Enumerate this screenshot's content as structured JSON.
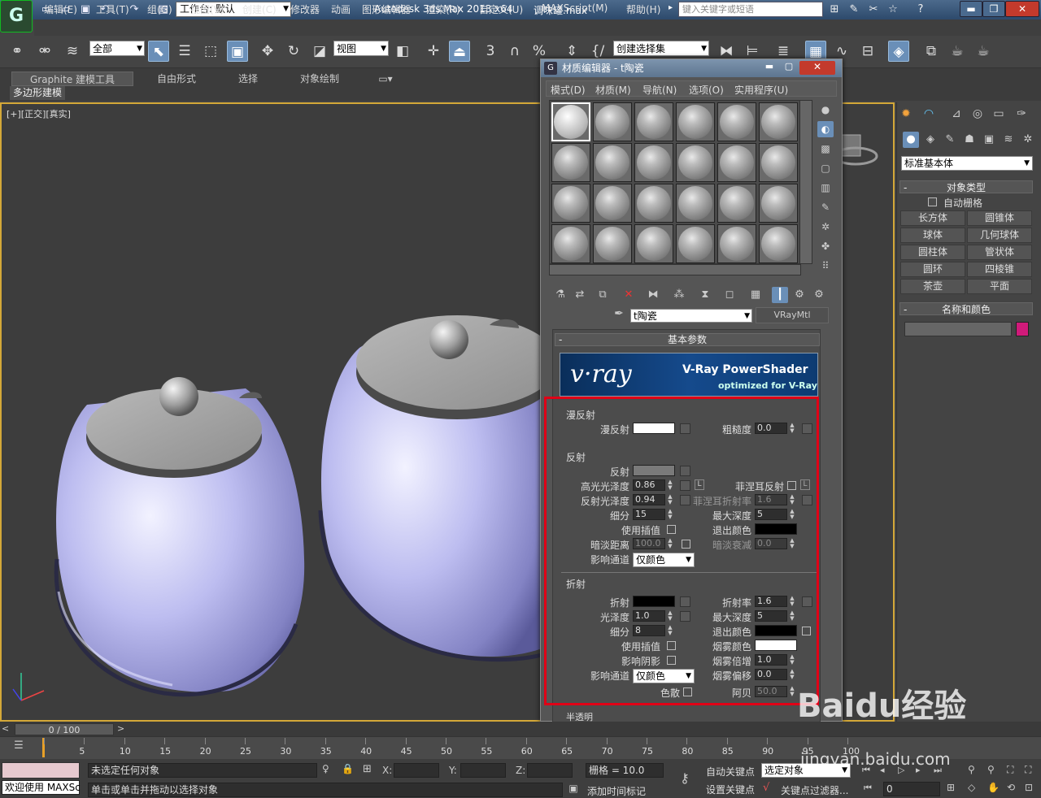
{
  "titlebar": {
    "app_icon": "3ds-max-logo",
    "workspace_label": "工作台: 默认",
    "app_title": "Autodesk 3ds Max  2013 x64",
    "file_name": "调味罐.max",
    "search_placeholder": "键入关键字或短语",
    "window_controls": [
      "minimize",
      "restore",
      "close"
    ]
  },
  "menubar": [
    "编辑(E)",
    "工具(T)",
    "组(G)",
    "视图(V)",
    "创建(C)",
    "修改器",
    "动画",
    "图形编辑器",
    "渲染(R)",
    "自定义(U)",
    "MAXScript(M)",
    "帮助(H)"
  ],
  "toolbar": {
    "selection_filter": "全部",
    "ref_coord": "视图",
    "named_selection": "创建选择集",
    "snap_number": "3",
    "percent_label": "%"
  },
  "ribbon": {
    "tabs": [
      "Graphite 建模工具",
      "自由形式",
      "选择",
      "对象绘制"
    ],
    "active_tab": "Graphite 建模工具",
    "subpanel": "多边形建模"
  },
  "viewport": {
    "label": "[+][正交][真实]"
  },
  "command_panel": {
    "category_dropdown": "标准基本体",
    "object_type_header": "对象类型",
    "autogrid_label": "自动栅格",
    "objects": [
      "长方体",
      "圆锥体",
      "球体",
      "几何球体",
      "圆柱体",
      "管状体",
      "圆环",
      "四棱锥",
      "茶壶",
      "平面"
    ],
    "name_color_header": "名称和颜色",
    "object_color": "#d01a7a"
  },
  "material_editor": {
    "title": "材质编辑器 - t陶瓷",
    "menus": [
      "模式(D)",
      "材质(M)",
      "导航(N)",
      "选项(O)",
      "实用程序(U)"
    ],
    "material_name": "t陶瓷",
    "material_type": "VRayMtl",
    "basic_params_header": "基本参数",
    "banner": {
      "logo": "v·ray",
      "line1": "V-Ray PowerShader",
      "line2": "optimized for V-Ray"
    },
    "diffuse": {
      "group": "漫反射",
      "diffuse_label": "漫反射",
      "diffuse_color": "#ffffff",
      "roughness_label": "粗糙度",
      "roughness": "0.0"
    },
    "reflection": {
      "group": "反射",
      "reflect_label": "反射",
      "reflect_color": "#7a7a7a",
      "hilight_gloss_label": "高光光泽度",
      "hilight_gloss": "0.86",
      "lock_label": "L",
      "fresnel_label": "菲涅耳反射",
      "fresnel_lock_label": "L",
      "refl_gloss_label": "反射光泽度",
      "refl_gloss": "0.94",
      "fresnel_ior_label": "菲涅耳折射率",
      "fresnel_ior": "1.6",
      "subdivs_label": "细分",
      "subdivs": "15",
      "max_depth_label": "最大深度",
      "max_depth": "5",
      "use_interp_label": "使用插值",
      "exit_color_label": "退出颜色",
      "exit_color": "#000000",
      "dim_dist_label": "暗淡距离",
      "dim_dist": "100.0",
      "dim_falloff_label": "暗淡衰减",
      "dim_falloff": "0.0",
      "affect_channels_label": "影响通道",
      "affect_channels": "仅颜色"
    },
    "refraction": {
      "group": "折射",
      "refract_label": "折射",
      "refract_color": "#000000",
      "ior_label": "折射率",
      "ior": "1.6",
      "gloss_label": "光泽度",
      "gloss": "1.0",
      "max_depth_label": "最大深度",
      "max_depth": "5",
      "subdivs_label": "细分",
      "subdivs": "8",
      "exit_color_label": "退出颜色",
      "exit_color": "#000000",
      "use_interp_label": "使用插值",
      "fog_color_label": "烟雾颜色",
      "fog_color": "#ffffff",
      "affect_shadows_label": "影响阴影",
      "fog_mult_label": "烟雾倍增",
      "fog_mult": "1.0",
      "affect_channels_label": "影响通道",
      "affect_channels": "仅颜色",
      "fog_bias_label": "烟雾偏移",
      "fog_bias": "0.0",
      "dispersion_label": "色散",
      "abbe_label": "阿贝",
      "abbe": "50.0"
    },
    "translucency_group": "半透明"
  },
  "timeline": {
    "slider_label": "0 / 100",
    "ticks": [
      "0",
      "5",
      "10",
      "15",
      "20",
      "25",
      "30",
      "35",
      "40",
      "45",
      "50",
      "55",
      "60",
      "65",
      "70",
      "75",
      "80",
      "85",
      "90",
      "95",
      "100"
    ]
  },
  "status": {
    "welcome": "欢迎使用 MAXSc",
    "selection": "未选定任何对象",
    "prompt": "单击或单击并拖动以选择对象",
    "x_label": "X:",
    "y_label": "Y:",
    "z_label": "Z:",
    "grid": "栅格 = 10.0",
    "add_time_tag": "添加时间标记",
    "auto_key": "自动关键点",
    "set_key": "设置关键点",
    "selected_object": "选定对象",
    "key_filters": "关键点过滤器...",
    "frame": "0"
  },
  "watermark": {
    "brand": "Baidu经验",
    "url": "jingyan.baidu.com"
  }
}
